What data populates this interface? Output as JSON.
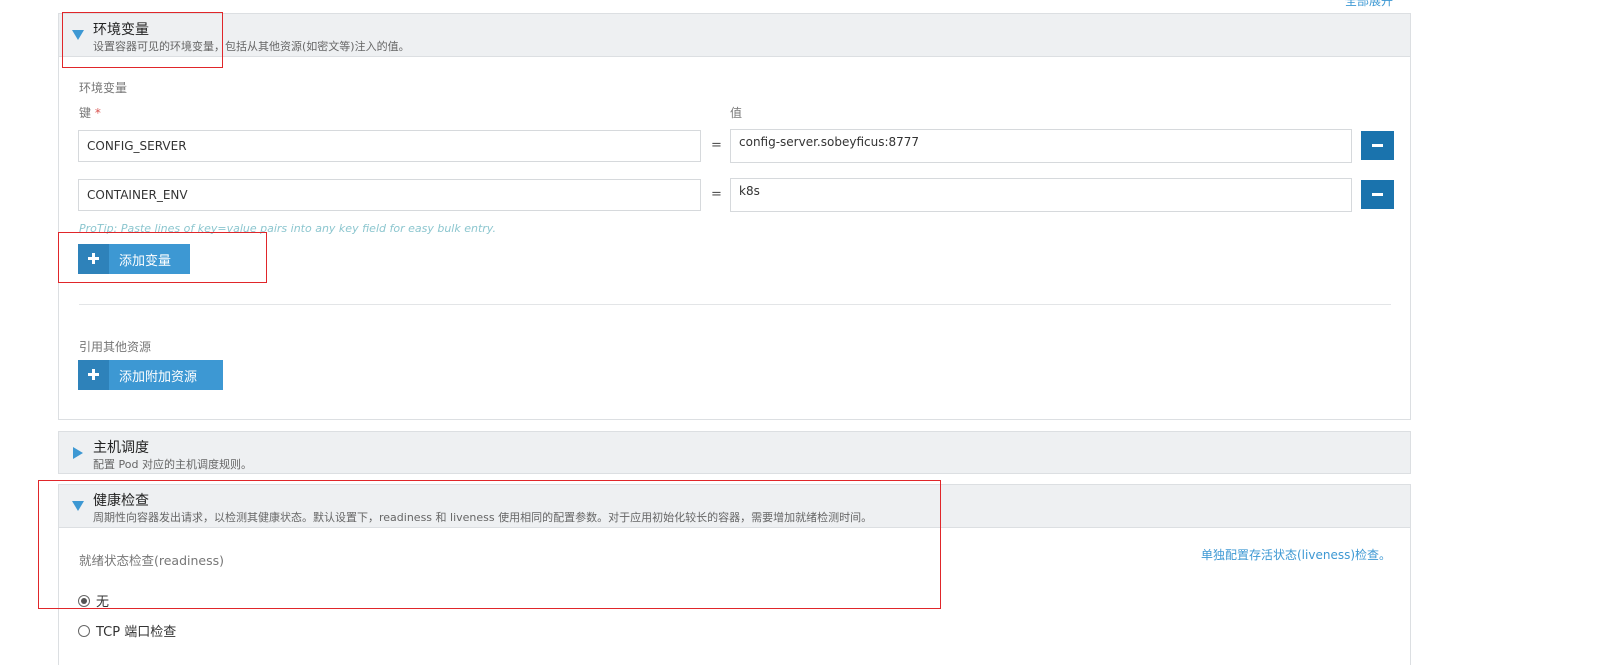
{
  "top": {
    "expand_all": "全部展开"
  },
  "env_section": {
    "title": "环境变量",
    "description": "设置容器可见的环境变量，包括从其他资源(如密文等)注入的值。",
    "subheading": "环境变量",
    "key_label": "键",
    "required_mark": "*",
    "value_label": "值",
    "rows": [
      {
        "key": "CONFIG_SERVER",
        "eq": "=",
        "value": "config-server.sobeyficus:8777"
      },
      {
        "key": "CONTAINER_ENV",
        "eq": "=",
        "value": "k8s"
      }
    ],
    "protip": "ProTip: Paste lines of key=value pairs into any key field for easy bulk entry.",
    "add_variable_label": "添加变量",
    "ref_heading": "引用其他资源",
    "add_resource_label": "添加附加资源"
  },
  "host_section": {
    "title": "主机调度",
    "description": "配置 Pod 对应的主机调度规则。"
  },
  "health_section": {
    "title": "健康检查",
    "description": "周期性向容器发出请求，以检测其健康状态。默认设置下，readiness 和 liveness 使用相同的配置参数。对于应用初始化较长的容器，需要增加就绪检测时间。",
    "readiness_label": "就绪状态检查(readiness)",
    "liveness_link": "单独配置存活状态(liveness)检查。",
    "options": [
      {
        "label": "无",
        "selected": true
      },
      {
        "label": "TCP 端口检查",
        "selected": false
      }
    ]
  },
  "colors": {
    "accent": "#3d98d3",
    "dark_button": "#1a73ad",
    "highlight_box": "#e0262a",
    "header_bg": "#eef0f2"
  }
}
